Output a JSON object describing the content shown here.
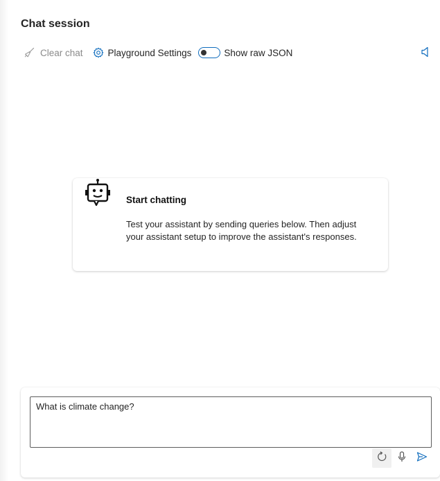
{
  "header": {
    "title": "Chat session"
  },
  "toolbar": {
    "clear_chat_label": "Clear chat",
    "settings_label": "Playground Settings",
    "raw_json_label": "Show raw JSON",
    "raw_json_on": false
  },
  "card": {
    "title": "Start chatting",
    "text": "Test your assistant by sending queries below. Then adjust your assistant setup to improve the assistant's responses."
  },
  "composer": {
    "input_value": "What is climate change?",
    "actions": [
      "refresh-icon",
      "microphone-icon",
      "send-icon"
    ]
  },
  "colors": {
    "accent": "#0f6cbd",
    "muted": "#8a8a8a"
  }
}
